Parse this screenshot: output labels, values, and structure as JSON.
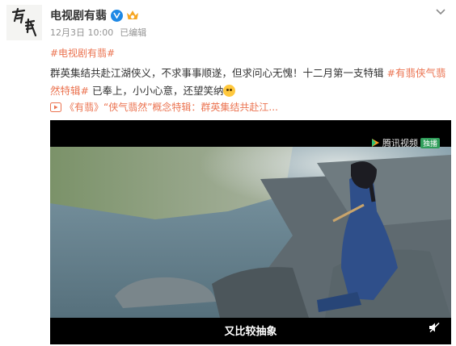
{
  "post": {
    "author": "电视剧有翡",
    "avatar_text": "有翡",
    "timestamp": "12月3日 10:00",
    "edited_label": "已编辑",
    "hashtag": "#电视剧有翡#",
    "body": {
      "part1": "群英集结共赴江湖侠义，不求事事顺遂，但求问心无愧！十二月第一支特辑 ",
      "tag": "#有翡侠气翡然特辑#",
      "part2": " 已奉上，小小心意，还望笑纳"
    },
    "link_text": "《有翡》“侠气翡然”概念特辑：群英集结共赴江..."
  },
  "video": {
    "watermark": "腾讯视频",
    "watermark_badge": "独播",
    "subtitle": "又比较抽象"
  },
  "icons": {
    "verified": "verified-v-icon",
    "member": "member-crown-icon",
    "menu": "chevron-down-icon",
    "link": "video-link-icon",
    "mute": "mute-icon"
  },
  "colors": {
    "accent": "#eb7350",
    "verified": "#1e88e5",
    "meta": "#939393"
  }
}
